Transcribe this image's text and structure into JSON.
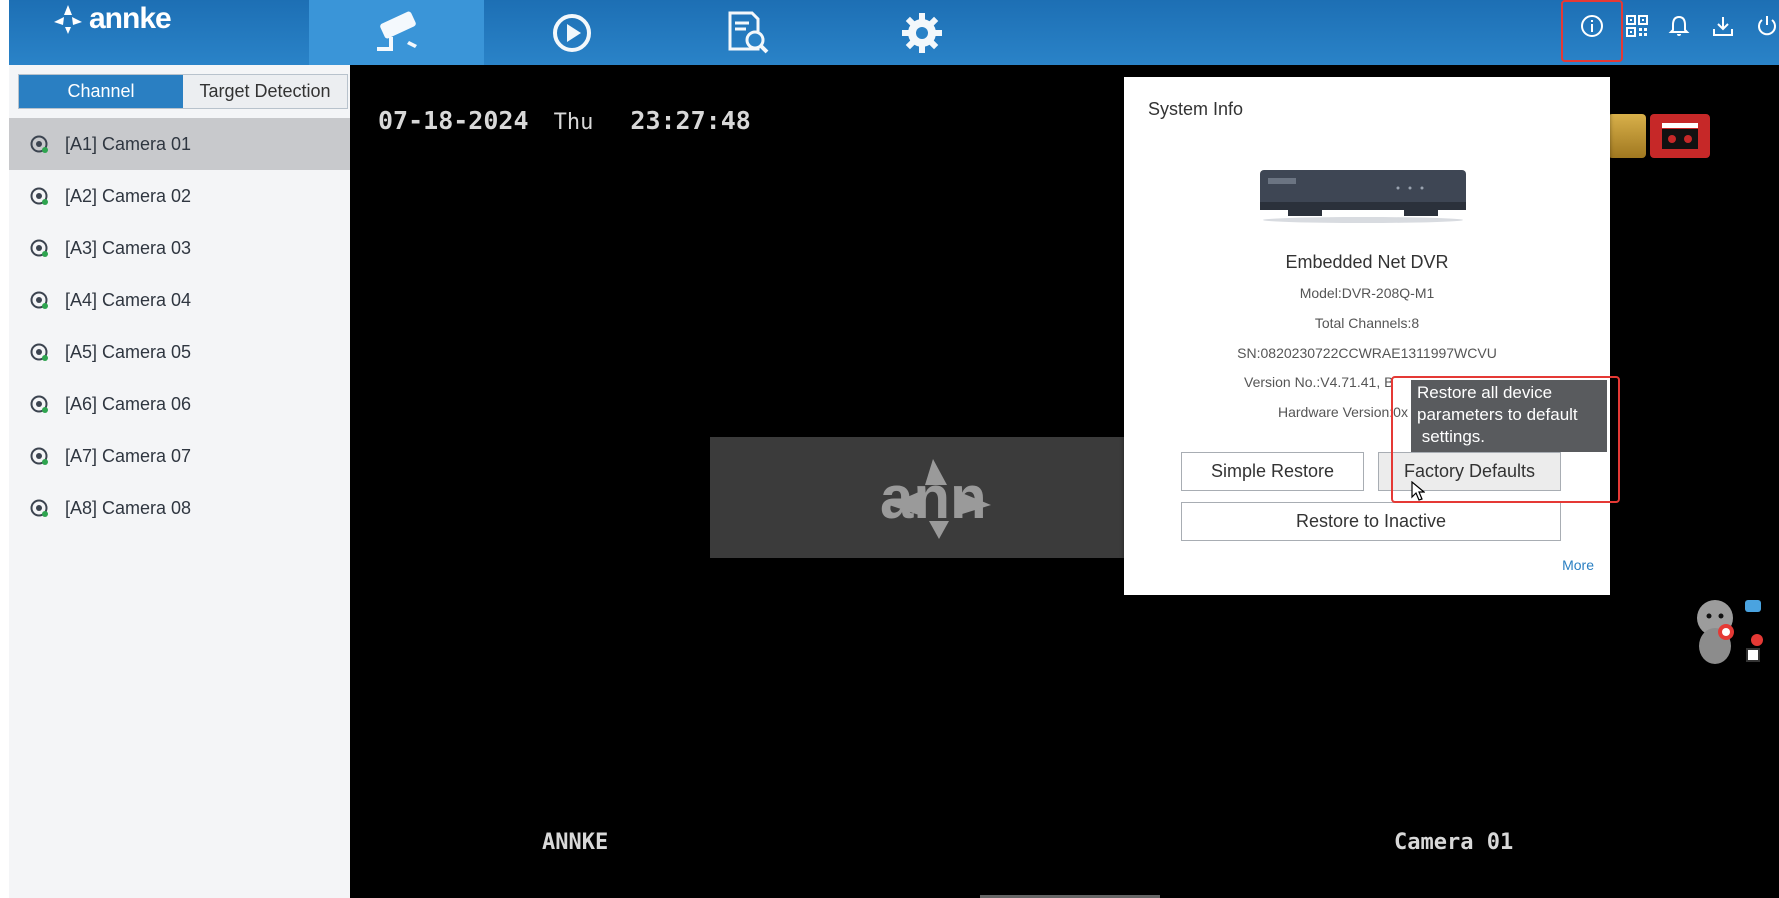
{
  "brand": {
    "logo_text": "annke"
  },
  "sidebar": {
    "tabs": [
      {
        "label": "Channel"
      },
      {
        "label": "Target Detection"
      }
    ],
    "cameras": [
      {
        "label": "[A1] Camera 01"
      },
      {
        "label": "[A2] Camera 02"
      },
      {
        "label": "[A3] Camera 03"
      },
      {
        "label": "[A4] Camera 04"
      },
      {
        "label": "[A5] Camera 05"
      },
      {
        "label": "[A6] Camera 06"
      },
      {
        "label": "[A7] Camera 07"
      },
      {
        "label": "[A8] Camera 08"
      }
    ]
  },
  "live": {
    "date": "07-18-2024",
    "weekday": "Thu",
    "time": "23:27:48",
    "bottom_left": "ANNKE",
    "bottom_right": "Camera 01",
    "watermark": "ann"
  },
  "system_info": {
    "title": "System Info",
    "device_name": "Embedded Net DVR",
    "model": "Model:DVR-208Q-M1",
    "channels": "Total Channels:8",
    "serial": "SN:0820230722CCWRAE1311997WCVU",
    "version": "Version No.:V4.71.41",
    "version_tail": ", B",
    "hardware": "Hardware Version:0x",
    "buttons": {
      "simple_restore": "Simple Restore",
      "factory_defaults": "Factory Defaults",
      "restore_inactive": "Restore to Inactive"
    },
    "more": "More"
  },
  "tooltip": {
    "line1": "Restore all device",
    "line2": "parameters to default",
    "line3": " settings."
  },
  "colors": {
    "topbar": "#2a83c8",
    "accent": "#2a7fc2",
    "highlight": "#e53935"
  }
}
